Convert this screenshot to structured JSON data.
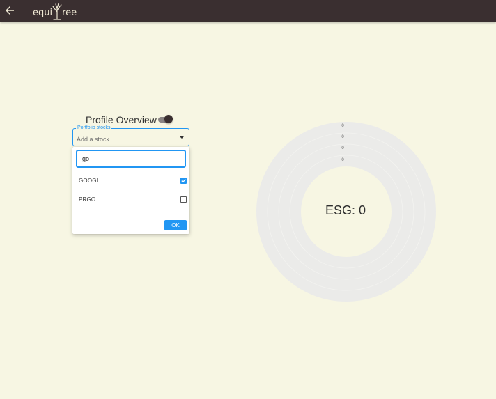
{
  "header": {
    "logo_left": "equi",
    "logo_right": "ree",
    "back_icon": "arrow-left-icon",
    "background": "#3a2f30"
  },
  "profile": {
    "title": "Profile Overview",
    "toggle_on": true
  },
  "portfolio_select": {
    "label": "Portfolio stocks",
    "placeholder": "Add a stock...",
    "search_value": "go",
    "options": [
      {
        "label": "GOOGL",
        "checked": true
      },
      {
        "label": "PRGO",
        "checked": false
      }
    ],
    "ok_label": "OK"
  },
  "esg": {
    "score_text": "ESG: 0",
    "ring_values": [
      "0",
      "0",
      "0",
      "0"
    ]
  },
  "colors": {
    "accent": "#2196f3",
    "page_background": "#f7f6e3",
    "ring": "#ebebe9"
  }
}
